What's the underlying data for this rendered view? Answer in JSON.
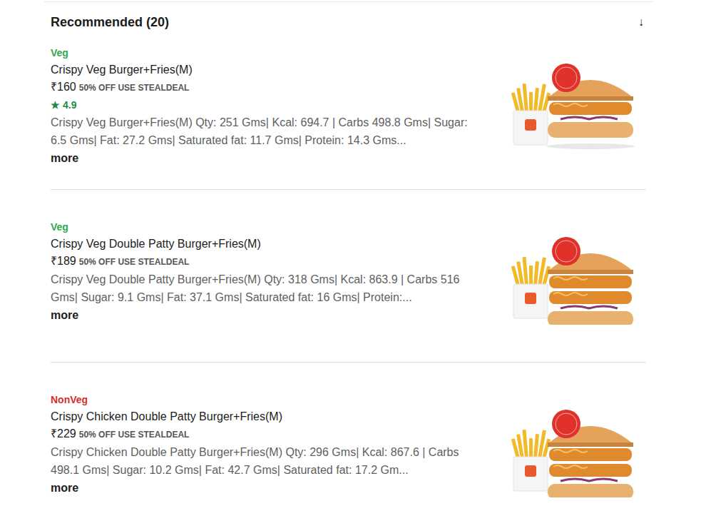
{
  "section": {
    "title": "Recommended (20)",
    "toggle": "↓"
  },
  "items": [
    {
      "type": "Veg",
      "color": "#2fa84f",
      "name": "Crispy Veg Burger+Fries(M)",
      "price": "₹160",
      "offer": "50% OFF USE STEALDEAL",
      "rating_icon": "★",
      "rating": "4.9",
      "description": "Crispy Veg Burger+Fries(M) Qty: 251 Gms| Kcal: 694.7 | Carbs 498.8 Gms| Sugar: 6.5 Gms| Fat: 27.2 Gms| Saturated fat: 11.7 Gms| Protein: 14.3 Gms...",
      "more": "more",
      "patties": 1
    },
    {
      "type": "Veg",
      "color": "#2fa84f",
      "name": "Crispy Veg Double Patty Burger+Fries(M)",
      "price": "₹189",
      "offer": "50% OFF USE STEALDEAL",
      "description": "Crispy Veg Double Patty Burger+Fries(M) Qty: 318 Gms| Kcal: 863.9 | Carbs 516 Gms| Sugar: 9.1 Gms| Fat: 37.1 Gms| Saturated fat: 16 Gms| Protein:...",
      "more": "more",
      "patties": 2
    },
    {
      "type": "NonVeg",
      "color": "#d32f2f",
      "name": "Crispy Chicken Double Patty Burger+Fries(M)",
      "price": "₹229",
      "offer": "50% OFF USE STEALDEAL",
      "description": "Crispy Chicken Double Patty Burger+Fries(M) Qty: 296 Gms| Kcal: 867.6 | Carbs 498.1 Gms| Sugar: 10.2 Gms| Fat: 42.7 Gms| Saturated fat: 17.2 Gm...",
      "more": "more",
      "patties": 2
    }
  ]
}
